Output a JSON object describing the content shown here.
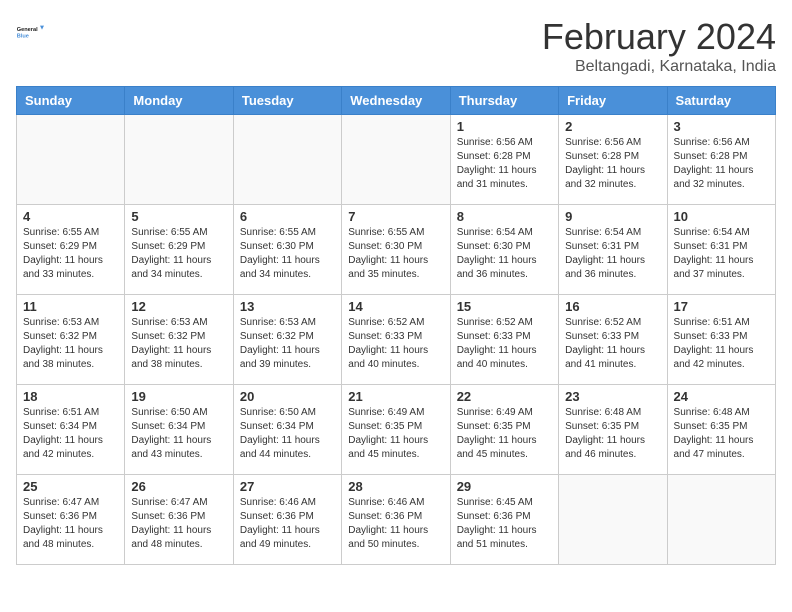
{
  "header": {
    "logo_general": "General",
    "logo_blue": "Blue",
    "month_title": "February 2024",
    "location": "Beltangadi, Karnataka, India"
  },
  "days_of_week": [
    "Sunday",
    "Monday",
    "Tuesday",
    "Wednesday",
    "Thursday",
    "Friday",
    "Saturday"
  ],
  "weeks": [
    [
      {
        "day": "",
        "sunrise": "",
        "sunset": "",
        "daylight": ""
      },
      {
        "day": "",
        "sunrise": "",
        "sunset": "",
        "daylight": ""
      },
      {
        "day": "",
        "sunrise": "",
        "sunset": "",
        "daylight": ""
      },
      {
        "day": "",
        "sunrise": "",
        "sunset": "",
        "daylight": ""
      },
      {
        "day": "1",
        "sunrise": "Sunrise: 6:56 AM",
        "sunset": "Sunset: 6:28 PM",
        "daylight": "Daylight: 11 hours and 31 minutes."
      },
      {
        "day": "2",
        "sunrise": "Sunrise: 6:56 AM",
        "sunset": "Sunset: 6:28 PM",
        "daylight": "Daylight: 11 hours and 32 minutes."
      },
      {
        "day": "3",
        "sunrise": "Sunrise: 6:56 AM",
        "sunset": "Sunset: 6:28 PM",
        "daylight": "Daylight: 11 hours and 32 minutes."
      }
    ],
    [
      {
        "day": "4",
        "sunrise": "Sunrise: 6:55 AM",
        "sunset": "Sunset: 6:29 PM",
        "daylight": "Daylight: 11 hours and 33 minutes."
      },
      {
        "day": "5",
        "sunrise": "Sunrise: 6:55 AM",
        "sunset": "Sunset: 6:29 PM",
        "daylight": "Daylight: 11 hours and 34 minutes."
      },
      {
        "day": "6",
        "sunrise": "Sunrise: 6:55 AM",
        "sunset": "Sunset: 6:30 PM",
        "daylight": "Daylight: 11 hours and 34 minutes."
      },
      {
        "day": "7",
        "sunrise": "Sunrise: 6:55 AM",
        "sunset": "Sunset: 6:30 PM",
        "daylight": "Daylight: 11 hours and 35 minutes."
      },
      {
        "day": "8",
        "sunrise": "Sunrise: 6:54 AM",
        "sunset": "Sunset: 6:30 PM",
        "daylight": "Daylight: 11 hours and 36 minutes."
      },
      {
        "day": "9",
        "sunrise": "Sunrise: 6:54 AM",
        "sunset": "Sunset: 6:31 PM",
        "daylight": "Daylight: 11 hours and 36 minutes."
      },
      {
        "day": "10",
        "sunrise": "Sunrise: 6:54 AM",
        "sunset": "Sunset: 6:31 PM",
        "daylight": "Daylight: 11 hours and 37 minutes."
      }
    ],
    [
      {
        "day": "11",
        "sunrise": "Sunrise: 6:53 AM",
        "sunset": "Sunset: 6:32 PM",
        "daylight": "Daylight: 11 hours and 38 minutes."
      },
      {
        "day": "12",
        "sunrise": "Sunrise: 6:53 AM",
        "sunset": "Sunset: 6:32 PM",
        "daylight": "Daylight: 11 hours and 38 minutes."
      },
      {
        "day": "13",
        "sunrise": "Sunrise: 6:53 AM",
        "sunset": "Sunset: 6:32 PM",
        "daylight": "Daylight: 11 hours and 39 minutes."
      },
      {
        "day": "14",
        "sunrise": "Sunrise: 6:52 AM",
        "sunset": "Sunset: 6:33 PM",
        "daylight": "Daylight: 11 hours and 40 minutes."
      },
      {
        "day": "15",
        "sunrise": "Sunrise: 6:52 AM",
        "sunset": "Sunset: 6:33 PM",
        "daylight": "Daylight: 11 hours and 40 minutes."
      },
      {
        "day": "16",
        "sunrise": "Sunrise: 6:52 AM",
        "sunset": "Sunset: 6:33 PM",
        "daylight": "Daylight: 11 hours and 41 minutes."
      },
      {
        "day": "17",
        "sunrise": "Sunrise: 6:51 AM",
        "sunset": "Sunset: 6:33 PM",
        "daylight": "Daylight: 11 hours and 42 minutes."
      }
    ],
    [
      {
        "day": "18",
        "sunrise": "Sunrise: 6:51 AM",
        "sunset": "Sunset: 6:34 PM",
        "daylight": "Daylight: 11 hours and 42 minutes."
      },
      {
        "day": "19",
        "sunrise": "Sunrise: 6:50 AM",
        "sunset": "Sunset: 6:34 PM",
        "daylight": "Daylight: 11 hours and 43 minutes."
      },
      {
        "day": "20",
        "sunrise": "Sunrise: 6:50 AM",
        "sunset": "Sunset: 6:34 PM",
        "daylight": "Daylight: 11 hours and 44 minutes."
      },
      {
        "day": "21",
        "sunrise": "Sunrise: 6:49 AM",
        "sunset": "Sunset: 6:35 PM",
        "daylight": "Daylight: 11 hours and 45 minutes."
      },
      {
        "day": "22",
        "sunrise": "Sunrise: 6:49 AM",
        "sunset": "Sunset: 6:35 PM",
        "daylight": "Daylight: 11 hours and 45 minutes."
      },
      {
        "day": "23",
        "sunrise": "Sunrise: 6:48 AM",
        "sunset": "Sunset: 6:35 PM",
        "daylight": "Daylight: 11 hours and 46 minutes."
      },
      {
        "day": "24",
        "sunrise": "Sunrise: 6:48 AM",
        "sunset": "Sunset: 6:35 PM",
        "daylight": "Daylight: 11 hours and 47 minutes."
      }
    ],
    [
      {
        "day": "25",
        "sunrise": "Sunrise: 6:47 AM",
        "sunset": "Sunset: 6:36 PM",
        "daylight": "Daylight: 11 hours and 48 minutes."
      },
      {
        "day": "26",
        "sunrise": "Sunrise: 6:47 AM",
        "sunset": "Sunset: 6:36 PM",
        "daylight": "Daylight: 11 hours and 48 minutes."
      },
      {
        "day": "27",
        "sunrise": "Sunrise: 6:46 AM",
        "sunset": "Sunset: 6:36 PM",
        "daylight": "Daylight: 11 hours and 49 minutes."
      },
      {
        "day": "28",
        "sunrise": "Sunrise: 6:46 AM",
        "sunset": "Sunset: 6:36 PM",
        "daylight": "Daylight: 11 hours and 50 minutes."
      },
      {
        "day": "29",
        "sunrise": "Sunrise: 6:45 AM",
        "sunset": "Sunset: 6:36 PM",
        "daylight": "Daylight: 11 hours and 51 minutes."
      },
      {
        "day": "",
        "sunrise": "",
        "sunset": "",
        "daylight": ""
      },
      {
        "day": "",
        "sunrise": "",
        "sunset": "",
        "daylight": ""
      }
    ]
  ]
}
